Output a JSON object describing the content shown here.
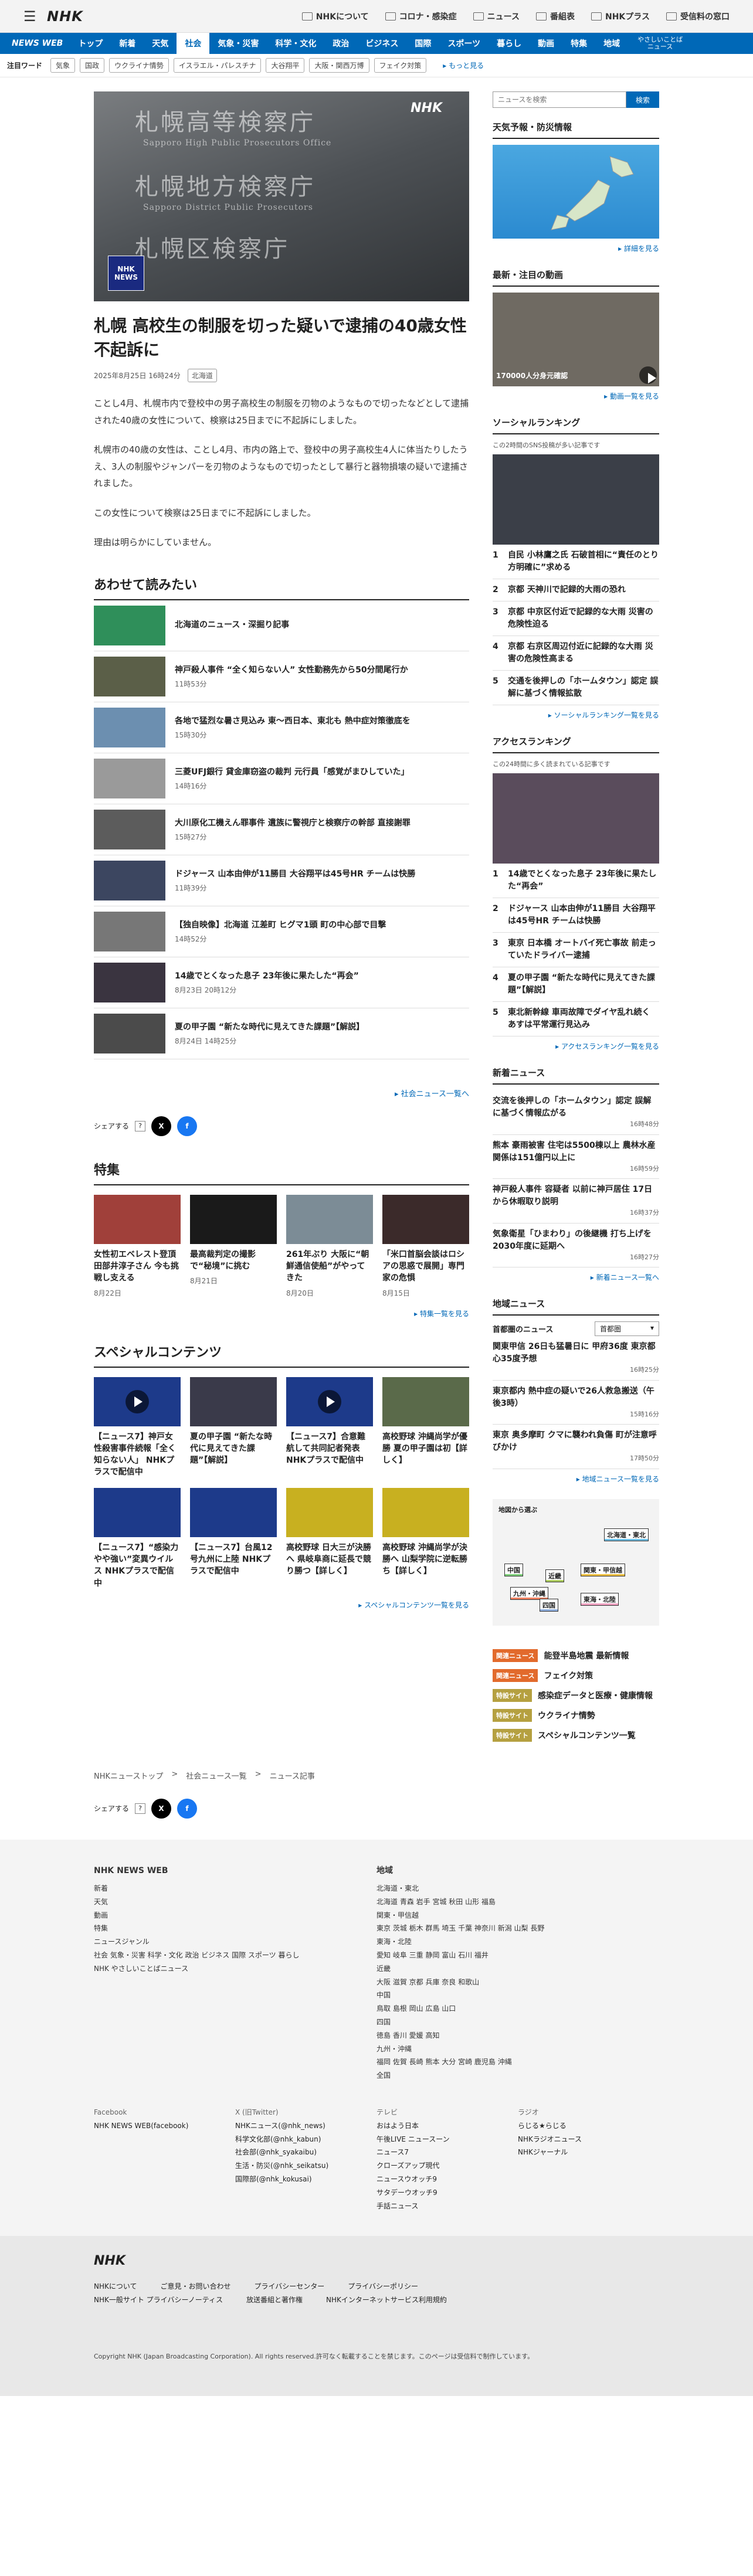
{
  "topnav": {
    "about": "NHKについて",
    "corona": "コロナ・感染症",
    "news": "ニュース",
    "program": "番組表",
    "plus": "NHKプラス",
    "reception": "受信料の窓口"
  },
  "catbar": {
    "brand": "NEWS WEB",
    "items": [
      "トップ",
      "新着",
      "天気",
      "社会",
      "気象・災害",
      "科学・文化",
      "政治",
      "ビジネス",
      "国際",
      "スポーツ",
      "暮らし",
      "動画",
      "特集",
      "地域"
    ],
    "easy1": "やさしいことば",
    "easy2": "ニュース"
  },
  "keywords": {
    "label": "注目ワード",
    "tags": [
      "気象",
      "国政",
      "ウクライナ情勢",
      "イスラエル・パレスチナ",
      "大谷翔平",
      "大阪・関西万博",
      "フェイク対策"
    ],
    "more": "もっと見る"
  },
  "hero": {
    "l1": "札幌高等検察庁",
    "l2": "Sapporo High Public Prosecutors Office",
    "l3": "札幌地方検察庁",
    "l4": "Sapporo District Public Prosecutors",
    "l5": "札幌区検察庁",
    "badge1": "NHK",
    "badge2": "NEWS",
    "corner": "NHK"
  },
  "article": {
    "title": "札幌 高校生の制服を切った疑いで逮捕の40歳女性 不起訴に",
    "date": "2025年8月25日 16時24分",
    "region": "北海道",
    "p1": "ことし4月、札幌市内で登校中の男子高校生の制服を刃物のようなもので切ったなどとして逮捕された40歳の女性について、検察は25日までに不起訴にしました。",
    "p2": "札幌市の40歳の女性は、ことし4月、市内の路上で、登校中の男子高校生4人に体当たりしたうえ、3人の制服やジャンパーを刃物のようなもので切ったとして暴行と器物損壊の疑いで逮捕されました。",
    "p3": "この女性について検察は25日までに不起訴にしました。",
    "p4": "理由は明らかにしていません。"
  },
  "related": {
    "heading": "あわせて読みたい",
    "items": [
      {
        "title": "北海道のニュース・深掘り記事",
        "date": ""
      },
      {
        "title": "神戸殺人事件 “全く知らない人” 女性勤務先から50分間尾行か",
        "date": "11時53分"
      },
      {
        "title": "各地で猛烈な暑さ見込み 東〜西日本、東北も 熱中症対策徹底を",
        "date": "15時30分"
      },
      {
        "title": "三菱UFJ銀行 貸金庫窃盗の裁判 元行員「感覚がまひしていた」",
        "date": "14時16分"
      },
      {
        "title": "大川原化工機えん罪事件 遺族に警視庁と検察庁の幹部 直接謝罪",
        "date": "15時27分"
      },
      {
        "title": "ドジャース 山本由伸が11勝目 大谷翔平は45号HR チームは快勝",
        "date": "11時39分"
      },
      {
        "title": "【独自映像】北海道 江差町 ヒグマ1頭 町の中心部で目撃",
        "date": "14時52分"
      },
      {
        "title": "14歳でとくなった息子 23年後に果たした“再会”",
        "date": "8月23日 20時12分"
      },
      {
        "title": "夏の甲子園 “新たな時代に見えてきた課題”【解説】",
        "date": "8月24日 14時25分"
      }
    ],
    "more": "社会ニュース一覧へ"
  },
  "share": {
    "label": "シェアする",
    "q": "?"
  },
  "features": {
    "heading": "特集",
    "items": [
      {
        "title": "女性初エベレスト登頂 田部井淳子さん 今も挑戦し支える",
        "date": "8月22日"
      },
      {
        "title": "最高裁判定の撮影で“秘境”に挑む",
        "date": "8月21日"
      },
      {
        "title": "261年ぶり 大阪に“朝鮮通信使船”がやってきた",
        "date": "8月20日"
      },
      {
        "title": "「米口首脳会談はロシアの思惑で展開」専門家の危惧",
        "date": "8月15日"
      }
    ],
    "more": "特集一覧を見る"
  },
  "special": {
    "heading": "スペシャルコンテンツ",
    "items": [
      {
        "title": "【ニュース7】神戸女性殺害事件続報「全く知らない人」 NHKプラスで配信中"
      },
      {
        "title": "夏の甲子園 “新たな時代に見えてきた課題”【解説】"
      },
      {
        "title": "【ニュース7】合意難航して共同記者発表 NHKプラスで配信中"
      },
      {
        "title": "高校野球 沖縄尚学が優勝 夏の甲子園は初【詳しく】"
      },
      {
        "title": "【ニュース7】“感染力やや強い”変異ウイルス NHKプラスで配信中"
      },
      {
        "title": "【ニュース7】台風12号九州に上陸 NHKプラスで配信中"
      },
      {
        "title": "高校野球 日大三が決勝へ 県岐阜商に延長で競り勝つ【詳しく】"
      },
      {
        "title": "高校野球 沖縄尚学が決勝へ 山梨学院に逆転勝ち【詳しく】"
      }
    ],
    "more": "スペシャルコンテンツ一覧を見る"
  },
  "sidebar": {
    "search": {
      "placeholder": "ニュースを検索",
      "button": "検索"
    },
    "weather": {
      "heading": "天気予報・防災情報",
      "more": "詳細を見る"
    },
    "video": {
      "heading": "最新・注目の動画",
      "caption": "170000人分身元確認",
      "more": "動画一覧を見る"
    },
    "social": {
      "heading": "ソーシャルランキング",
      "desc": "この2時間のSNS投稿が多い記事です",
      "items": [
        "自民 小林鷹之氏 石破首相に“責任のとり方明確に”求める",
        "京都 天神川で記録的大雨の恐れ",
        "京都 中京区付近で記録的な大雨 災害の危険性迫る",
        "京都 右京区周辺付近に記録的な大雨 災害の危険性高まる",
        "交通を後押しの「ホームタウン」認定 誤解に基づく情報拡散"
      ],
      "more": "ソーシャルランキング一覧を見る"
    },
    "access": {
      "heading": "アクセスランキング",
      "desc": "この24時間に多く読まれている記事です",
      "items": [
        "14歳でとくなった息子 23年後に果たした“再会”",
        "ドジャース 山本由伸が11勝目 大谷翔平は45号HR チームは快勝",
        "東京 日本橋 オートバイ死亡事故 前走っていたドライバー逮捕",
        "夏の甲子園 “新たな時代に見えてきた課題”【解説】",
        "東北新幹線 車両故障でダイヤ乱れ続く あすは平常運行見込み"
      ],
      "more": "アクセスランキング一覧を見る"
    },
    "latest": {
      "heading": "新着ニュース",
      "items": [
        {
          "title": "交流を後押しの「ホームタウン」認定 誤解に基づく情報広がる",
          "date": "16時48分"
        },
        {
          "title": "熊本 豪雨被害 住宅は5500棟以上 農林水産関係は151億円以上に",
          "date": "16時59分"
        },
        {
          "title": "神戸殺人事件 容疑者 以前に神戸居住 17日から休暇取り説明",
          "date": "16時37分"
        },
        {
          "title": "気象衛星「ひまわり」の後継機 打ち上げを2030年度に延期へ",
          "date": "16時27分"
        }
      ],
      "more": "新着ニュース一覧へ"
    },
    "regional": {
      "heading": "地域ニュース",
      "area": "首都圏のニュース",
      "select": "首都圏",
      "items": [
        {
          "title": "関東甲信 26日も猛暑日に 甲府36度 東京都心35度予想",
          "date": "16時25分"
        },
        {
          "title": "東京都内 熱中症の疑いで26人救急搬送（午後3時）",
          "date": "15時16分"
        },
        {
          "title": "東京 奥多摩町 クマに襲われ負傷 町が注意呼びかけ",
          "date": "17時50分"
        }
      ],
      "more": "地域ニュース一覧を見る"
    },
    "map": {
      "heading": "地図から選ぶ",
      "regions": [
        "北海道・東北",
        "中国",
        "近畿",
        "関東・甲信越",
        "九州・沖縄",
        "四国",
        "東海・北陸"
      ]
    },
    "pills": [
      {
        "label": "関連ニュース",
        "text": "能登半島地震 最新情報",
        "kind": "n"
      },
      {
        "label": "関連ニュース",
        "text": "フェイク対策",
        "kind": "n"
      },
      {
        "label": "特設サイト",
        "text": "感染症データと医療・健康情報",
        "kind": "s"
      },
      {
        "label": "特設サイト",
        "text": "ウクライナ情勢",
        "kind": "s"
      },
      {
        "label": "特設サイト",
        "text": "スペシャルコンテンツ一覧",
        "kind": "s"
      }
    ]
  },
  "breadcrumb": [
    "NHKニューストップ",
    "社会ニュース一覧",
    "ニュース記事"
  ],
  "footer": {
    "brand": "NHK NEWS WEB",
    "col1": [
      "新着",
      "天気",
      "動画",
      "特集",
      "ニュースジャンル",
      "社会 気象・災害 科学・文化 政治 ビジネス 国際 スポーツ 暮らし",
      "NHK やさしいことばニュース"
    ],
    "regionH": "地域",
    "regions": [
      "北海道・東北",
      "北海道 青森 岩手 宮城 秋田 山形 福島",
      "関東・甲信越",
      "東京 茨城 栃木 群馬 埼玉 千葉 神奈川 新潟 山梨 長野",
      "東海・北陸",
      "愛知 岐阜 三重 静岡 富山 石川 福井",
      "近畿",
      "大阪 滋賀 京都 兵庫 奈良 和歌山",
      "中国",
      "鳥取 島根 岡山 広島 山口",
      "四国",
      "徳島 香川 愛媛 高知",
      "九州・沖縄",
      "福岡 佐賀 長崎 熊本 大分 宮崎 鹿児島 沖縄",
      "全国"
    ],
    "social": [
      {
        "h": "Facebook",
        "items": [
          "NHK NEWS WEB(facebook)"
        ]
      },
      {
        "h": "X (旧Twitter)",
        "items": [
          "NHKニュース(@nhk_news)",
          "科学文化部(@nhk_kabun)",
          "社会部(@nhk_syakaibu)",
          "生活・防災(@nhk_seikatsu)",
          "国際部(@nhk_kokusai)"
        ]
      },
      {
        "h": "テレビ",
        "items": [
          "おはよう日本",
          "午後LIVE ニュースーン",
          "ニュース7",
          "クローズアップ現代",
          "ニュースウオッチ9",
          "サタデーウオッチ9",
          "手話ニュース"
        ]
      },
      {
        "h": "ラジオ",
        "items": [
          "らじる★らじる",
          "NHKラジオニュース",
          "NHKジャーナル"
        ]
      }
    ],
    "bottomLogo": "NHK",
    "links": [
      "NHKについて",
      "ご意見・お問い合わせ",
      "プライバシーセンター",
      "プライバシーポリシー",
      "NHK一般サイト プライバシーノーティス",
      "放送番組と著作権",
      "NHKインターネットサービス利用規約"
    ],
    "copyright": "Copyright NHK (Japan Broadcasting Corporation). All rights reserved.許可なく転載することを禁じます。このページは受信料で制作しています。"
  }
}
